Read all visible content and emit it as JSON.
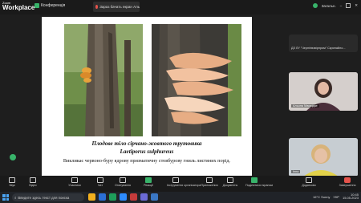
{
  "app": {
    "logo_top": "Zoom",
    "logo_bottom": "Workplace",
    "meeting_label": "Конференція"
  },
  "presenter": {
    "label": "Зараз бачать екран Альони Мамкідзе"
  },
  "window_controls": {
    "status": "Загальн."
  },
  "slide": {
    "caption_title": "Плодове тіло сірчано-жовтого трутовика",
    "caption_latin": "Laetiporus sulphureus",
    "caption_desc": "Викликає червоно-буру ядрову призматичну стовбурову гниль листяних порід."
  },
  "participants": [
    {
      "name": "ДЗ ЛУ \"Чернігівзвірпром\" Скрипайло..."
    },
    {
      "name": "Альона Мамкідзе"
    },
    {
      "name": "Іnna"
    }
  ],
  "toolbar": {
    "buttons": [
      "Звук",
      "Відео",
      "Учасники",
      "Чат",
      "Опитування",
      "Реакції",
      "Інструменти організатора",
      "Приложения",
      "Документы",
      "Поділитися екраном",
      "Додатково",
      "Завершення"
    ],
    "participants_count": "2"
  },
  "taskbar": {
    "search_placeholder": "Введите здесь текст для поиска",
    "weather": "16°C  Sunny",
    "language": "УКР",
    "time": "10:45",
    "date": "15.05.2023"
  },
  "colors": {
    "accent": "#38b36a",
    "end": "#e5534b",
    "bg": "#1e1e1e"
  }
}
